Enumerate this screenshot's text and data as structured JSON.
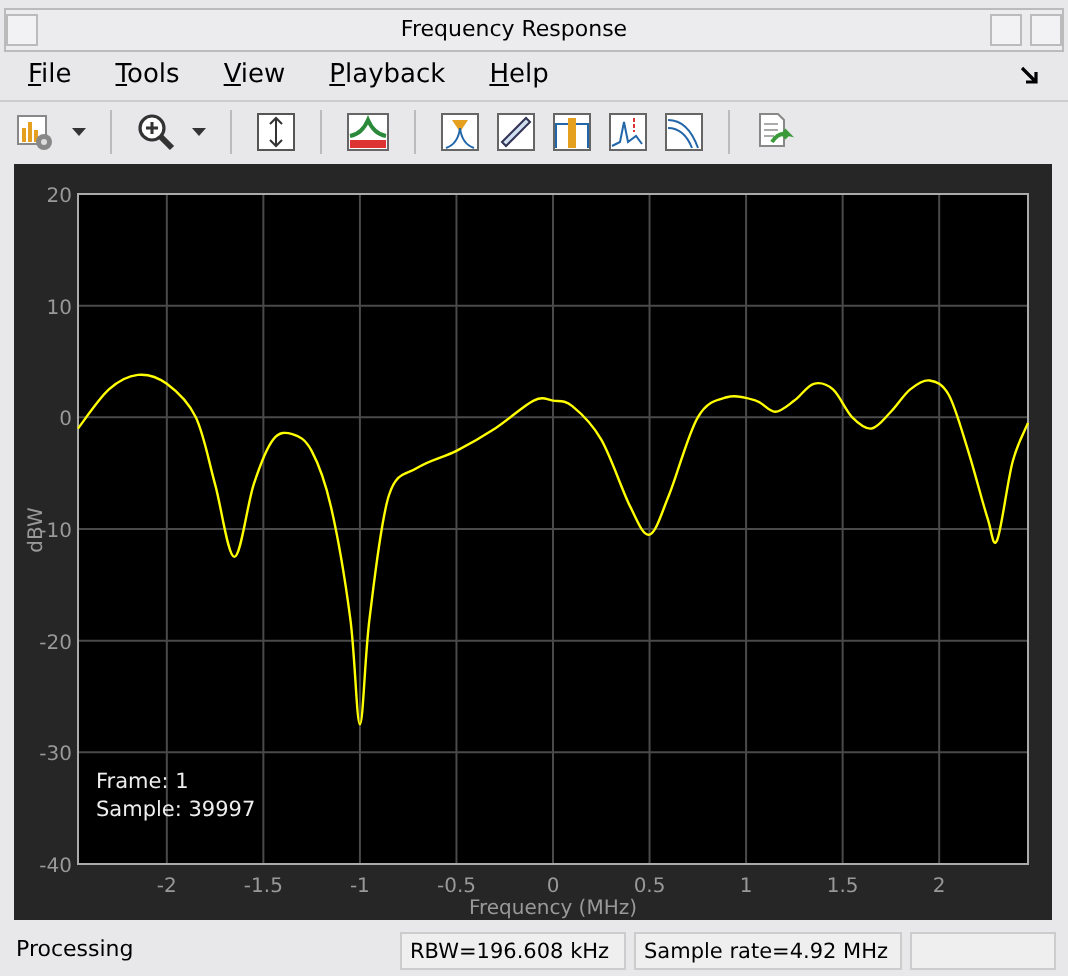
{
  "window": {
    "title": "Frequency Response"
  },
  "menu": [
    {
      "label": "File"
    },
    {
      "label": "Tools"
    },
    {
      "label": "View"
    },
    {
      "label": "Playback"
    },
    {
      "label": "Help"
    }
  ],
  "plot": {
    "overlay": [
      "Frame: 1",
      "Sample: 39997"
    ],
    "chart_data": {
      "type": "line",
      "xlabel": "Frequency (MHz)",
      "ylabel": "dBW",
      "xlim": [
        -2.46,
        2.46
      ],
      "ylim": [
        -40,
        20
      ],
      "xticks": [
        -2,
        -1.5,
        -1,
        -0.5,
        0,
        0.5,
        1,
        1.5,
        2
      ],
      "yticks": [
        -40,
        -30,
        -20,
        -10,
        0,
        10,
        20
      ],
      "x": [
        -2.46,
        -2.3,
        -2.15,
        -2.0,
        -1.85,
        -1.75,
        -1.65,
        -1.55,
        -1.45,
        -1.35,
        -1.25,
        -1.15,
        -1.05,
        -1.0,
        -0.95,
        -0.85,
        -0.7,
        -0.5,
        -0.3,
        -0.1,
        0,
        0.1,
        0.25,
        0.4,
        0.5,
        0.6,
        0.75,
        0.9,
        1.05,
        1.15,
        1.25,
        1.35,
        1.45,
        1.55,
        1.65,
        1.75,
        1.85,
        1.95,
        2.05,
        2.15,
        2.25,
        2.3,
        2.38,
        2.46
      ],
      "grid": true,
      "series": [
        {
          "color": "#ffff00",
          "values": [
            -1,
            2.5,
            3.8,
            3,
            0,
            -6,
            -12.5,
            -6,
            -2,
            -1.5,
            -3,
            -8,
            -18,
            -27.5,
            -18,
            -7,
            -4.5,
            -3,
            -1,
            1.5,
            1.5,
            1,
            -2,
            -8,
            -10.5,
            -7,
            0,
            1.8,
            1.5,
            0.5,
            1.5,
            3,
            2.5,
            0,
            -1,
            0.5,
            2.5,
            3.3,
            2,
            -3,
            -9,
            -11,
            -4,
            -0.5
          ]
        }
      ]
    }
  },
  "status_bar": [
    {
      "text": "Processing"
    },
    {
      "text": "RBW=196.608 kHz"
    },
    {
      "text": "Sample rate=4.92 MHz"
    }
  ]
}
